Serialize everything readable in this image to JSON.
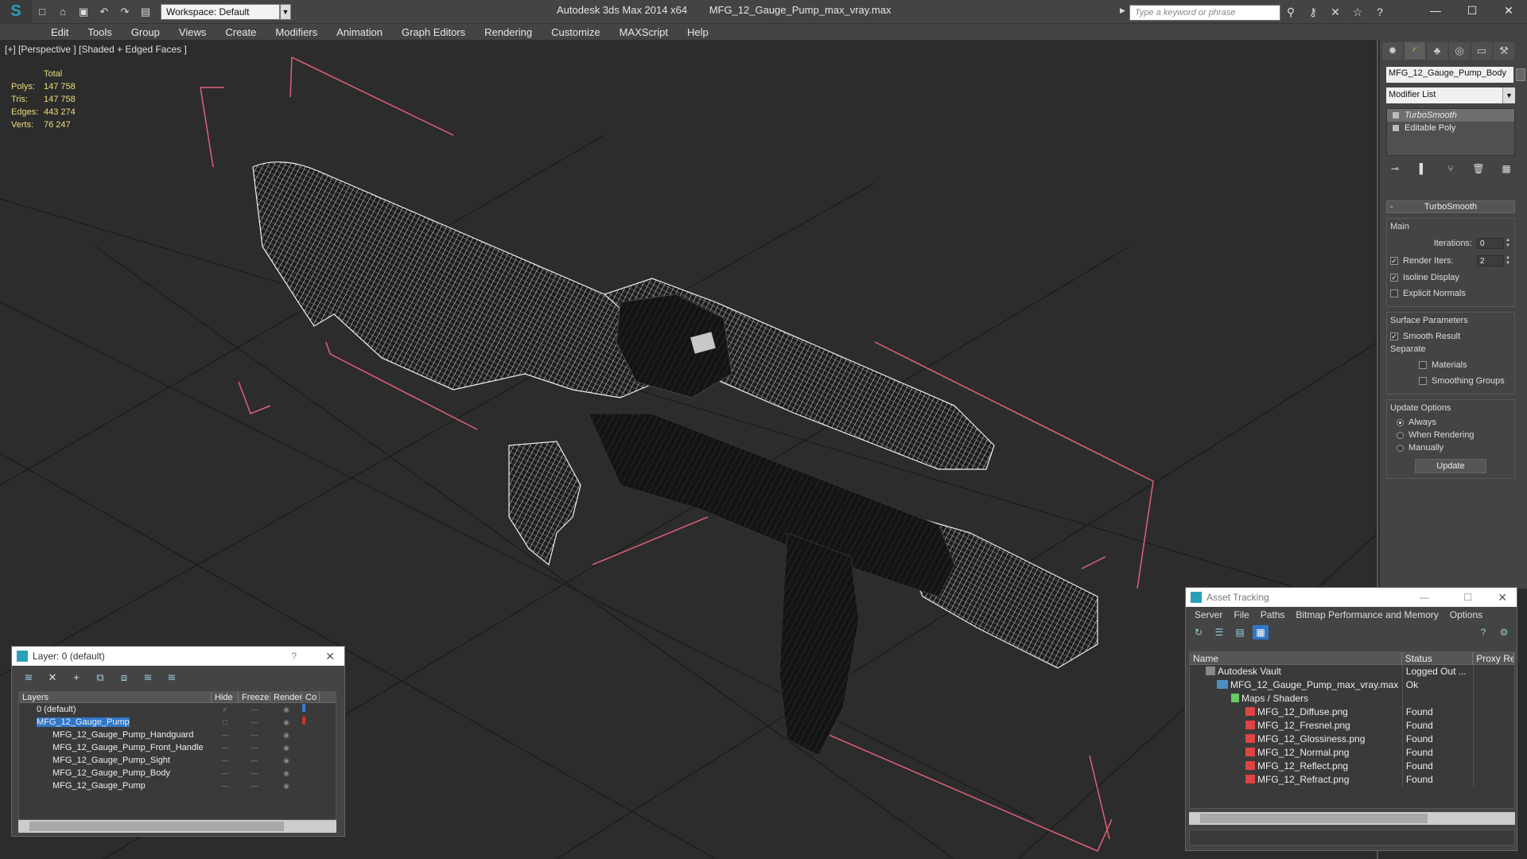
{
  "app": {
    "title": "Autodesk 3ds Max  2014 x64",
    "filename": "MFG_12_Gauge_Pump_max_vray.max",
    "workspace": "Workspace: Default",
    "search_placeholder": "Type a keyword or phrase"
  },
  "menu": [
    "Edit",
    "Tools",
    "Group",
    "Views",
    "Create",
    "Modifiers",
    "Animation",
    "Graph Editors",
    "Rendering",
    "Customize",
    "MAXScript",
    "Help"
  ],
  "viewport": {
    "label": "[+] [Perspective ] [Shaded + Edged Faces ]",
    "stats": {
      "header": "Total",
      "rows": [
        {
          "key": "Polys:",
          "value": "147 758"
        },
        {
          "key": "Tris:",
          "value": "147 758"
        },
        {
          "key": "Edges:",
          "value": "443 274"
        },
        {
          "key": "Verts:",
          "value": "76 247"
        }
      ]
    }
  },
  "command_panel": {
    "object_name": "MFG_12_Gauge_Pump_Body",
    "modifier_list": "Modifier List",
    "stack": [
      "TurboSmooth",
      "Editable Poly"
    ],
    "rollout_title": "TurboSmooth",
    "main_group": "Main",
    "iterations_label": "Iterations:",
    "iterations_value": "0",
    "render_iters_label": "Render Iters:",
    "render_iters_value": "2",
    "isoline_display": "Isoline Display",
    "explicit_normals": "Explicit Normals",
    "surface_group": "Surface Parameters",
    "smooth_result": "Smooth Result",
    "separate_label": "Separate",
    "materials": "Materials",
    "smoothing_groups": "Smoothing Groups",
    "update_group": "Update Options",
    "always": "Always",
    "when_rendering": "When Rendering",
    "manually": "Manually",
    "update_button": "Update"
  },
  "layer_dialog": {
    "title": "Layer: 0 (default)",
    "help": "?",
    "columns": [
      "Layers",
      "Hide",
      "Freeze",
      "Render",
      "Co"
    ],
    "rows": [
      {
        "name": "0 (default)",
        "indent": 1
      },
      {
        "name": "MFG_12_Gauge_Pump",
        "indent": 1,
        "selected": true
      },
      {
        "name": "MFG_12_Gauge_Pump_Handguard",
        "indent": 2
      },
      {
        "name": "MFG_12_Gauge_Pump_Front_Handle",
        "indent": 2
      },
      {
        "name": "MFG_12_Gauge_Pump_Sight",
        "indent": 2
      },
      {
        "name": "MFG_12_Gauge_Pump_Body",
        "indent": 2
      },
      {
        "name": "MFG_12_Gauge_Pump",
        "indent": 2
      }
    ]
  },
  "asset_tracking": {
    "title": "Asset Tracking",
    "menu": [
      "Server",
      "File",
      "Paths",
      "Bitmap Performance and Memory",
      "Options"
    ],
    "columns": [
      "Name",
      "Status",
      "Proxy Re"
    ],
    "rows": [
      {
        "name": "Autodesk Vault",
        "status": "Logged Out ...",
        "icon": "vault-icon",
        "indent": 1
      },
      {
        "name": "MFG_12_Gauge_Pump_max_vray.max",
        "status": "Ok",
        "icon": "max-file-icon",
        "indent": 2
      },
      {
        "name": "Maps / Shaders",
        "status": "",
        "icon": "folder-icon",
        "indent": 3
      },
      {
        "name": "MFG_12_Diffuse.png",
        "status": "Found",
        "icon": "png-icon",
        "indent": 4
      },
      {
        "name": "MFG_12_Fresnel.png",
        "status": "Found",
        "icon": "png-icon",
        "indent": 4
      },
      {
        "name": "MFG_12_Glossiness.png",
        "status": "Found",
        "icon": "png-icon",
        "indent": 4
      },
      {
        "name": "MFG_12_Normal.png",
        "status": "Found",
        "icon": "png-icon",
        "indent": 4
      },
      {
        "name": "MFG_12_Reflect.png",
        "status": "Found",
        "icon": "png-icon",
        "indent": 4
      },
      {
        "name": "MFG_12_Refract.png",
        "status": "Found",
        "icon": "png-icon",
        "indent": 4
      }
    ]
  }
}
